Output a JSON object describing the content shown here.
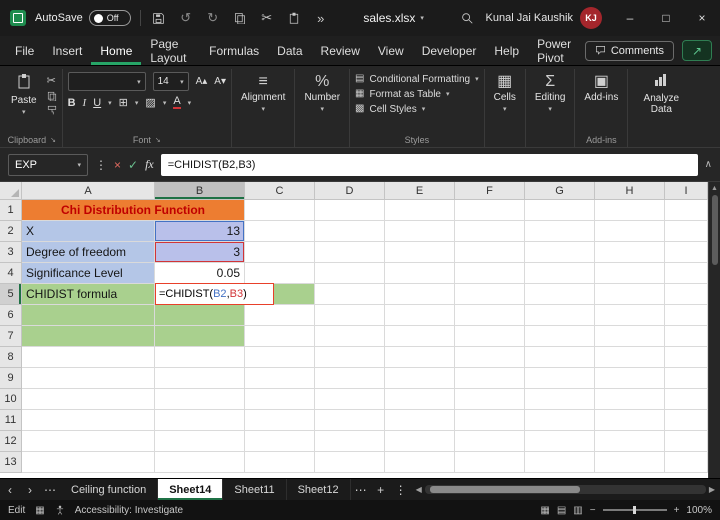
{
  "colors": {
    "accent_green": "#1e7145",
    "tab_underline_green": "#27a567",
    "orange_fill": "#ed7d31",
    "title_text_red": "#c00000",
    "blue_fill": "#b4c6e7",
    "green_fill": "#a9d08e",
    "ref_blue": "#4472c4",
    "ref_red": "#d13438",
    "avatar_bg": "#a4262c"
  },
  "glyphs": {
    "dropdown": "▾",
    "overflow": "»",
    "undo": "↺",
    "redo": "↻",
    "cut": "✂",
    "more_v": "⋮",
    "more_h": "⋯",
    "prev": "‹",
    "next": "›",
    "left": "◀",
    "right": "▶",
    "up": "▲",
    "plus": "+",
    "minimize": "–",
    "maximize": "□",
    "close": "×",
    "expand": "∧",
    "dialog": "↘",
    "borders": "⊞",
    "fill": "▨",
    "align": "≡",
    "percent": "%",
    "cells_icon": "▦",
    "editing_icon": "Σ",
    "addins_icon": "▣",
    "cf_icon": "▤",
    "table_icon": "▦",
    "cellstyles_icon": "▩",
    "grow_font": "A▴",
    "shrink_font": "A▾",
    "view_normal": "▦",
    "view_layout": "▤",
    "view_break": "▥",
    "zoom_out": "−",
    "zoom_in": "+",
    "macro": "▦"
  },
  "titlebar": {
    "autosave_label": "AutoSave",
    "autosave_state": "Off",
    "filename": "sales.xlsx",
    "user_name": "Kunal Jai Kaushik",
    "user_initials": "KJ"
  },
  "menubar": {
    "tabs": [
      "File",
      "Insert",
      "Home",
      "Page Layout",
      "Formulas",
      "Data",
      "Review",
      "View",
      "Developer",
      "Help",
      "Power Pivot"
    ],
    "active_tab": "Home",
    "comments": "Comments"
  },
  "ribbon": {
    "paste": "Paste",
    "clipboard_group": "Clipboard",
    "font_group": "Font",
    "font_name": "",
    "font_size": "14",
    "bold": "B",
    "italic": "I",
    "underline": "U",
    "font_color_letter": "A",
    "alignment": "Alignment",
    "number": "Number",
    "styles_group": "Styles",
    "conditional_formatting": "Conditional Formatting",
    "format_as_table": "Format as Table",
    "cell_styles": "Cell Styles",
    "cells": "Cells",
    "editing": "Editing",
    "addins": "Add-ins",
    "addins_group": "Add-ins",
    "analyze_data": "Analyze Data"
  },
  "formula_bar": {
    "name_box": "EXP",
    "cancel": "×",
    "enter": "✓",
    "fx": "fx",
    "formula": "=CHIDIST(B2,B3)"
  },
  "grid": {
    "column_headers": [
      "A",
      "B",
      "C",
      "D",
      "E",
      "F",
      "G",
      "H",
      "I"
    ],
    "row_headers": [
      "1",
      "2",
      "3",
      "4",
      "5",
      "6",
      "7",
      "8",
      "9",
      "10",
      "11",
      "12",
      "13"
    ],
    "selected_column": "B",
    "active_row": "5",
    "cells": [
      {
        "row": 1,
        "col": "A",
        "span": 2,
        "text": "Chi Distribution Function",
        "style": "title-orange"
      },
      {
        "row": 2,
        "col": "A",
        "text": "X",
        "style": "blue"
      },
      {
        "row": 2,
        "col": "B",
        "text": "13",
        "style": "blue num ref-blue"
      },
      {
        "row": 3,
        "col": "A",
        "text": "Degree of freedom",
        "style": "blue"
      },
      {
        "row": 3,
        "col": "B",
        "text": "3",
        "style": "blue num ref-red"
      },
      {
        "row": 4,
        "col": "A",
        "text": "Significance Level",
        "style": "blue"
      },
      {
        "row": 4,
        "col": "B",
        "text": "0.05",
        "style": "num"
      },
      {
        "row": 5,
        "col": "A",
        "text": "CHIDIST formula",
        "style": "green"
      },
      {
        "row": 5,
        "col": "B",
        "style": "edit-cell",
        "parts": [
          {
            "text": "=CHIDIST(",
            "color": "#000000"
          },
          {
            "text": "B2",
            "color": "#4472c4"
          },
          {
            "text": ",",
            "color": "#000000"
          },
          {
            "text": "B3",
            "color": "#d13438"
          },
          {
            "text": ")",
            "color": "#000000"
          }
        ]
      },
      {
        "row": 5,
        "col": "C",
        "style": "green"
      },
      {
        "row": 6,
        "col": "A",
        "style": "green"
      },
      {
        "row": 6,
        "col": "B",
        "style": "green"
      },
      {
        "row": 7,
        "col": "A",
        "style": "green"
      },
      {
        "row": 7,
        "col": "B",
        "style": "green"
      }
    ]
  },
  "sheet_tabs": {
    "tabs": [
      {
        "label": "Ceiling function",
        "active": false
      },
      {
        "label": "Sheet14",
        "active": true
      },
      {
        "label": "Sheet11",
        "active": false
      },
      {
        "label": "Sheet12",
        "active": false
      }
    ]
  },
  "status_bar": {
    "mode": "Edit",
    "accessibility": "Accessibility: Investigate",
    "zoom_level": "100%"
  }
}
